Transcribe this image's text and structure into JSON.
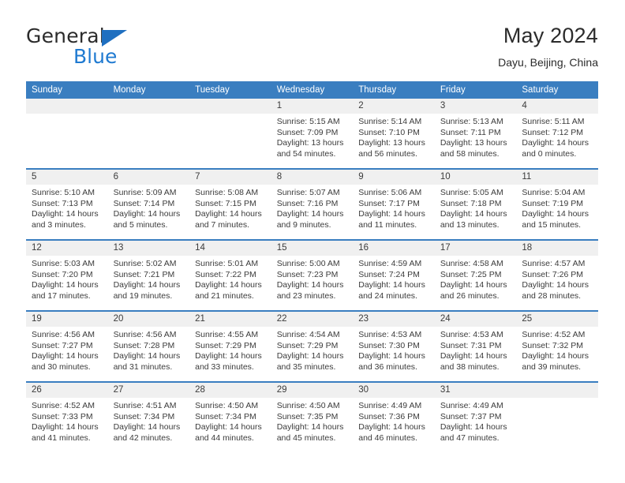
{
  "brand": {
    "name_top": "General",
    "name_bottom": "Blue",
    "triangle_color": "#1f6fc0",
    "blue_color": "#1f7ad1"
  },
  "header": {
    "title": "May 2024",
    "subtitle": "Dayu, Beijing, China"
  },
  "theme": {
    "header_blue": "#3a7ec0",
    "band_gray": "#f0f0f0",
    "text": "#3b3b3b"
  },
  "weekday_headers": [
    "Sunday",
    "Monday",
    "Tuesday",
    "Wednesday",
    "Thursday",
    "Friday",
    "Saturday"
  ],
  "labels": {
    "sunrise": "Sunrise:",
    "sunset": "Sunset:",
    "daylight": "Daylight:"
  },
  "weeks": [
    [
      {
        "day": "",
        "sunrise": "",
        "sunset": "",
        "daylight": ""
      },
      {
        "day": "",
        "sunrise": "",
        "sunset": "",
        "daylight": ""
      },
      {
        "day": "",
        "sunrise": "",
        "sunset": "",
        "daylight": ""
      },
      {
        "day": "1",
        "sunrise": "Sunrise: 5:15 AM",
        "sunset": "Sunset: 7:09 PM",
        "daylight": "Daylight: 13 hours and 54 minutes."
      },
      {
        "day": "2",
        "sunrise": "Sunrise: 5:14 AM",
        "sunset": "Sunset: 7:10 PM",
        "daylight": "Daylight: 13 hours and 56 minutes."
      },
      {
        "day": "3",
        "sunrise": "Sunrise: 5:13 AM",
        "sunset": "Sunset: 7:11 PM",
        "daylight": "Daylight: 13 hours and 58 minutes."
      },
      {
        "day": "4",
        "sunrise": "Sunrise: 5:11 AM",
        "sunset": "Sunset: 7:12 PM",
        "daylight": "Daylight: 14 hours and 0 minutes."
      }
    ],
    [
      {
        "day": "5",
        "sunrise": "Sunrise: 5:10 AM",
        "sunset": "Sunset: 7:13 PM",
        "daylight": "Daylight: 14 hours and 3 minutes."
      },
      {
        "day": "6",
        "sunrise": "Sunrise: 5:09 AM",
        "sunset": "Sunset: 7:14 PM",
        "daylight": "Daylight: 14 hours and 5 minutes."
      },
      {
        "day": "7",
        "sunrise": "Sunrise: 5:08 AM",
        "sunset": "Sunset: 7:15 PM",
        "daylight": "Daylight: 14 hours and 7 minutes."
      },
      {
        "day": "8",
        "sunrise": "Sunrise: 5:07 AM",
        "sunset": "Sunset: 7:16 PM",
        "daylight": "Daylight: 14 hours and 9 minutes."
      },
      {
        "day": "9",
        "sunrise": "Sunrise: 5:06 AM",
        "sunset": "Sunset: 7:17 PM",
        "daylight": "Daylight: 14 hours and 11 minutes."
      },
      {
        "day": "10",
        "sunrise": "Sunrise: 5:05 AM",
        "sunset": "Sunset: 7:18 PM",
        "daylight": "Daylight: 14 hours and 13 minutes."
      },
      {
        "day": "11",
        "sunrise": "Sunrise: 5:04 AM",
        "sunset": "Sunset: 7:19 PM",
        "daylight": "Daylight: 14 hours and 15 minutes."
      }
    ],
    [
      {
        "day": "12",
        "sunrise": "Sunrise: 5:03 AM",
        "sunset": "Sunset: 7:20 PM",
        "daylight": "Daylight: 14 hours and 17 minutes."
      },
      {
        "day": "13",
        "sunrise": "Sunrise: 5:02 AM",
        "sunset": "Sunset: 7:21 PM",
        "daylight": "Daylight: 14 hours and 19 minutes."
      },
      {
        "day": "14",
        "sunrise": "Sunrise: 5:01 AM",
        "sunset": "Sunset: 7:22 PM",
        "daylight": "Daylight: 14 hours and 21 minutes."
      },
      {
        "day": "15",
        "sunrise": "Sunrise: 5:00 AM",
        "sunset": "Sunset: 7:23 PM",
        "daylight": "Daylight: 14 hours and 23 minutes."
      },
      {
        "day": "16",
        "sunrise": "Sunrise: 4:59 AM",
        "sunset": "Sunset: 7:24 PM",
        "daylight": "Daylight: 14 hours and 24 minutes."
      },
      {
        "day": "17",
        "sunrise": "Sunrise: 4:58 AM",
        "sunset": "Sunset: 7:25 PM",
        "daylight": "Daylight: 14 hours and 26 minutes."
      },
      {
        "day": "18",
        "sunrise": "Sunrise: 4:57 AM",
        "sunset": "Sunset: 7:26 PM",
        "daylight": "Daylight: 14 hours and 28 minutes."
      }
    ],
    [
      {
        "day": "19",
        "sunrise": "Sunrise: 4:56 AM",
        "sunset": "Sunset: 7:27 PM",
        "daylight": "Daylight: 14 hours and 30 minutes."
      },
      {
        "day": "20",
        "sunrise": "Sunrise: 4:56 AM",
        "sunset": "Sunset: 7:28 PM",
        "daylight": "Daylight: 14 hours and 31 minutes."
      },
      {
        "day": "21",
        "sunrise": "Sunrise: 4:55 AM",
        "sunset": "Sunset: 7:29 PM",
        "daylight": "Daylight: 14 hours and 33 minutes."
      },
      {
        "day": "22",
        "sunrise": "Sunrise: 4:54 AM",
        "sunset": "Sunset: 7:29 PM",
        "daylight": "Daylight: 14 hours and 35 minutes."
      },
      {
        "day": "23",
        "sunrise": "Sunrise: 4:53 AM",
        "sunset": "Sunset: 7:30 PM",
        "daylight": "Daylight: 14 hours and 36 minutes."
      },
      {
        "day": "24",
        "sunrise": "Sunrise: 4:53 AM",
        "sunset": "Sunset: 7:31 PM",
        "daylight": "Daylight: 14 hours and 38 minutes."
      },
      {
        "day": "25",
        "sunrise": "Sunrise: 4:52 AM",
        "sunset": "Sunset: 7:32 PM",
        "daylight": "Daylight: 14 hours and 39 minutes."
      }
    ],
    [
      {
        "day": "26",
        "sunrise": "Sunrise: 4:52 AM",
        "sunset": "Sunset: 7:33 PM",
        "daylight": "Daylight: 14 hours and 41 minutes."
      },
      {
        "day": "27",
        "sunrise": "Sunrise: 4:51 AM",
        "sunset": "Sunset: 7:34 PM",
        "daylight": "Daylight: 14 hours and 42 minutes."
      },
      {
        "day": "28",
        "sunrise": "Sunrise: 4:50 AM",
        "sunset": "Sunset: 7:34 PM",
        "daylight": "Daylight: 14 hours and 44 minutes."
      },
      {
        "day": "29",
        "sunrise": "Sunrise: 4:50 AM",
        "sunset": "Sunset: 7:35 PM",
        "daylight": "Daylight: 14 hours and 45 minutes."
      },
      {
        "day": "30",
        "sunrise": "Sunrise: 4:49 AM",
        "sunset": "Sunset: 7:36 PM",
        "daylight": "Daylight: 14 hours and 46 minutes."
      },
      {
        "day": "31",
        "sunrise": "Sunrise: 4:49 AM",
        "sunset": "Sunset: 7:37 PM",
        "daylight": "Daylight: 14 hours and 47 minutes."
      },
      {
        "day": "",
        "sunrise": "",
        "sunset": "",
        "daylight": ""
      }
    ]
  ]
}
